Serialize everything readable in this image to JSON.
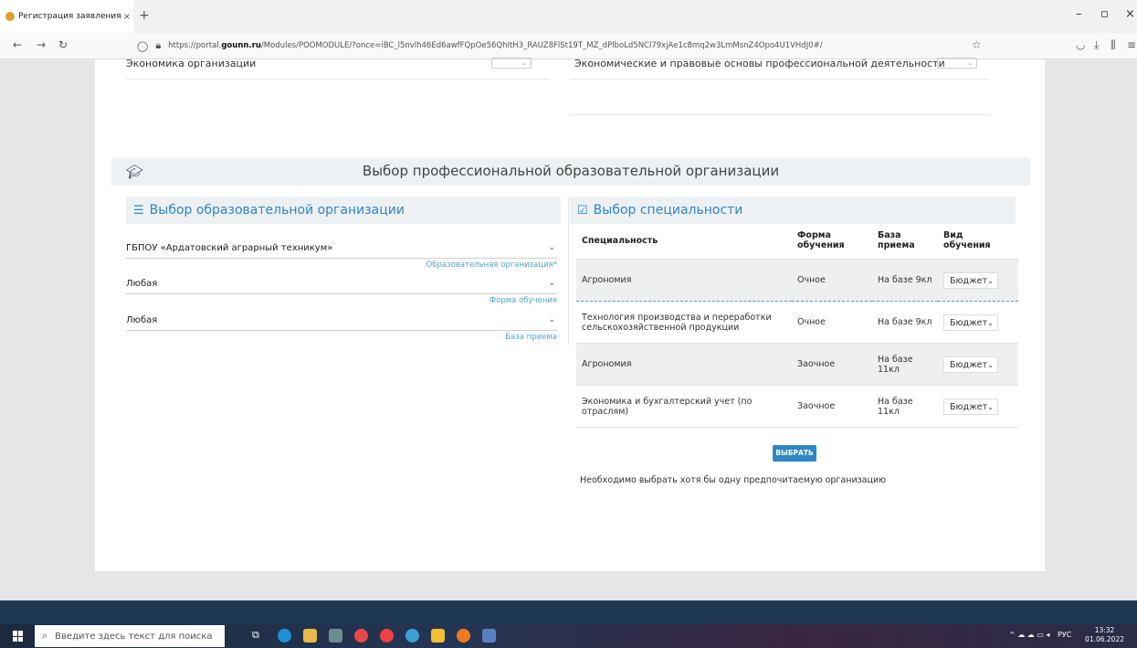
{
  "browser": {
    "tab_title": "Регистрация заявления | Порт",
    "tab_close": "×",
    "new_tab": "+",
    "url_prefix": "https://portal.",
    "url_domain": "gounn.ru",
    "url_rest": "/Modules/POOMODULE/?once=iBC_l5nvlh46Ed6awfFQpOe56QhItH3_RAUZ8FlSt19T_MZ_dPlboLd5NCl79xjAe1c8mq2w3LmMsnZ4Opo4U1VHdJ0#/"
  },
  "prev_section": {
    "left_subject": "Экономика организации",
    "right_subject": "Экономические и правовые основы профессиональной деятельности"
  },
  "section": {
    "title": "Выбор профессиональной образовательной организации"
  },
  "left_panel": {
    "title": "Выбор образовательной организации",
    "fields": [
      {
        "value": "ГБПОУ «Ардатовский аграрный техникум»",
        "label": "Образовательная организация*"
      },
      {
        "value": "Любая",
        "label": "Форма обучения"
      },
      {
        "value": "Любая",
        "label": "База приема"
      }
    ]
  },
  "right_panel": {
    "title": "Выбор специальности",
    "columns": [
      "Специальность",
      "Форма обучения",
      "База приема",
      "Вид обучения"
    ],
    "rows": [
      {
        "specialty": "Агрономия",
        "form": "Очное",
        "base": "На базе 9кл",
        "type": "Бюджет"
      },
      {
        "specialty": "Технология производства и переработки сельскохозяйственной продукции",
        "form": "Очное",
        "base": "На базе 9кл",
        "type": "Бюджет"
      },
      {
        "specialty": "Агрономия",
        "form": "Заочное",
        "base": "На базе 11кл",
        "type": "Бюджет"
      },
      {
        "specialty": "Экономика и бухгалтерский учет (по отраслям)",
        "form": "Заочное",
        "base": "На базе 11кл",
        "type": "Бюджет"
      }
    ],
    "select_button": "ВЫБРАТЬ",
    "note": "Необходимо выбрать хотя бы одну предпочитаемую организацию"
  },
  "taskbar": {
    "search_placeholder": "Введите здесь текст для поиска",
    "lang": "РУС",
    "time": "13:32",
    "date": "01.06.2022"
  }
}
